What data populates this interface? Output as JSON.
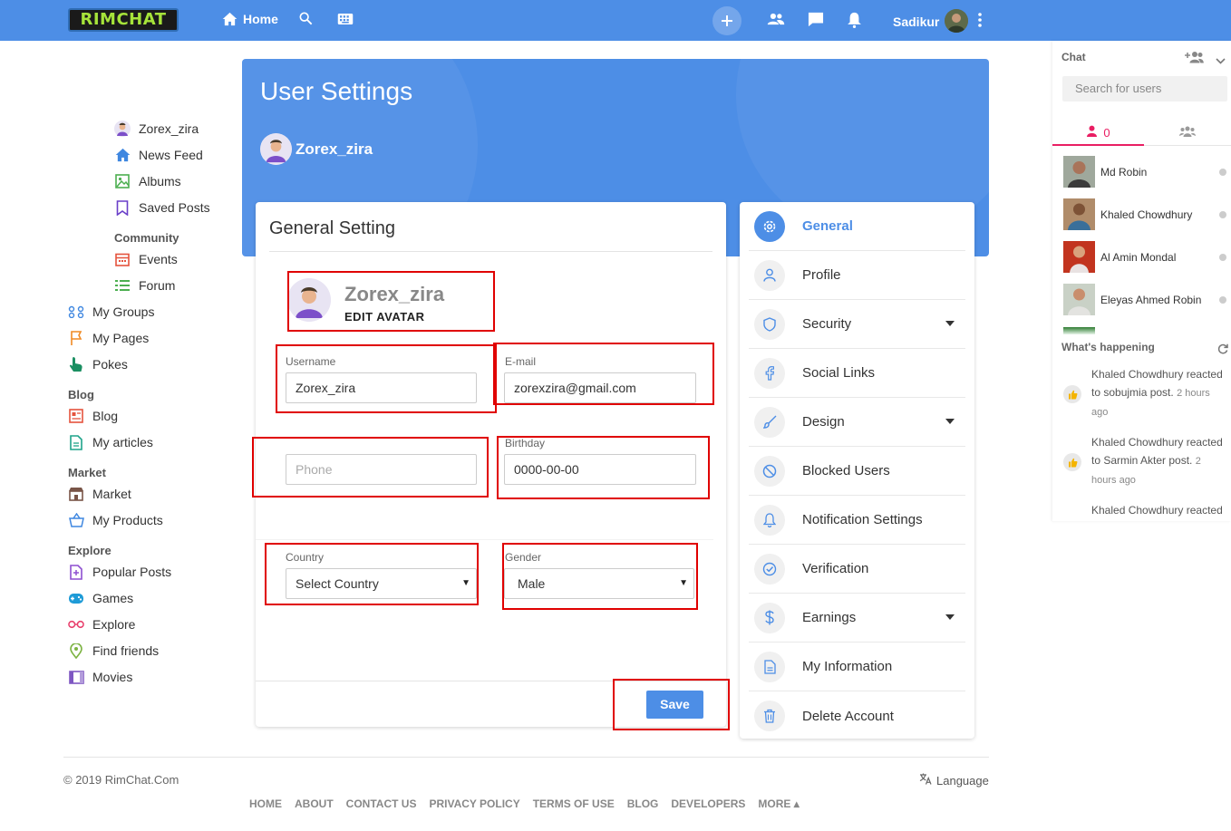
{
  "topbar": {
    "logo": "RIMCHAT",
    "home_label": "Home",
    "user_name": "Sadikur"
  },
  "sidebar": {
    "items_top": [
      {
        "label": "Zorex_zira",
        "icon": "user-avatar-icon"
      },
      {
        "label": "News Feed",
        "icon": "home-icon"
      },
      {
        "label": "Albums",
        "icon": "image-icon"
      },
      {
        "label": "Saved Posts",
        "icon": "bookmark-icon"
      }
    ],
    "community_heading": "Community",
    "community_items": [
      {
        "label": "Events",
        "icon": "calendar-icon"
      },
      {
        "label": "Forum",
        "icon": "list-icon"
      },
      {
        "label": "My Groups",
        "icon": "group-icon"
      },
      {
        "label": "My Pages",
        "icon": "flag-icon"
      },
      {
        "label": "Pokes",
        "icon": "poke-hand-icon"
      }
    ],
    "blog_heading": "Blog",
    "blog_items": [
      {
        "label": "Blog",
        "icon": "blog-icon"
      },
      {
        "label": "My articles",
        "icon": "article-icon"
      }
    ],
    "market_heading": "Market",
    "market_items": [
      {
        "label": "Market",
        "icon": "store-icon"
      },
      {
        "label": "My Products",
        "icon": "basket-icon"
      }
    ],
    "explore_heading": "Explore",
    "explore_items": [
      {
        "label": "Popular Posts",
        "icon": "popular-icon"
      },
      {
        "label": "Games",
        "icon": "gamepad-icon"
      },
      {
        "label": "Explore",
        "icon": "glasses-icon"
      },
      {
        "label": "Find friends",
        "icon": "location-pin-icon"
      },
      {
        "label": "Movies",
        "icon": "movie-icon"
      }
    ]
  },
  "hero": {
    "title": "User Settings",
    "username": "Zorex_zira"
  },
  "general": {
    "title": "General Setting",
    "avatar_name": "Zorex_zira",
    "edit_avatar": "EDIT AVATAR",
    "username_label": "Username",
    "username_value": "Zorex_zira",
    "email_label": "E-mail",
    "email_value": "zorexzira@gmail.com",
    "phone_placeholder": "Phone",
    "birthday_label": "Birthday",
    "birthday_value": "0000-00-00",
    "country_label": "Country",
    "country_value": "Select Country",
    "gender_label": "Gender",
    "gender_value": "Male",
    "save_label": "Save"
  },
  "settings_menu": [
    {
      "label": "General",
      "icon": "gear-icon",
      "active": true,
      "caret": false
    },
    {
      "label": "Profile",
      "icon": "person-icon",
      "active": false,
      "caret": false
    },
    {
      "label": "Security",
      "icon": "shield-icon",
      "active": false,
      "caret": true
    },
    {
      "label": "Social Links",
      "icon": "facebook-icon",
      "active": false,
      "caret": false
    },
    {
      "label": "Design",
      "icon": "brush-icon",
      "active": false,
      "caret": true
    },
    {
      "label": "Blocked Users",
      "icon": "block-icon",
      "active": false,
      "caret": false
    },
    {
      "label": "Notification Settings",
      "icon": "bell-icon",
      "active": false,
      "caret": false
    },
    {
      "label": "Verification",
      "icon": "check-circle-icon",
      "active": false,
      "caret": false
    },
    {
      "label": "Earnings",
      "icon": "dollar-icon",
      "active": false,
      "caret": true
    },
    {
      "label": "My Information",
      "icon": "document-icon",
      "active": false,
      "caret": false
    },
    {
      "label": "Delete Account",
      "icon": "trash-icon",
      "active": false,
      "caret": false
    }
  ],
  "chat": {
    "title": "Chat",
    "search_placeholder": "Search for users",
    "online_count": "0",
    "contacts": [
      {
        "name": "Md Robin"
      },
      {
        "name": "Khaled Chowdhury"
      },
      {
        "name": "Al Amin Mondal"
      },
      {
        "name": "Eleyas Ahmed Robin"
      }
    ],
    "happening_title": "What's happening",
    "activities": [
      {
        "text": "Khaled Chowdhury reacted to sobujmia post.",
        "time": "2 hours ago"
      },
      {
        "text": "Khaled Chowdhury reacted to Sarmin Akter post.",
        "time": "2 hours ago"
      },
      {
        "text": "Khaled Chowdhury reacted",
        "time": ""
      }
    ]
  },
  "footer": {
    "copyright": "© 2019 RimChat.Com",
    "language": "Language",
    "links": [
      "HOME",
      "ABOUT",
      "CONTACT US",
      "PRIVACY POLICY",
      "TERMS OF USE",
      "BLOG",
      "DEVELOPERS",
      "MORE ▴"
    ]
  },
  "colors": {
    "primary": "#4d8ee6",
    "annotation_red": "#e00000"
  }
}
